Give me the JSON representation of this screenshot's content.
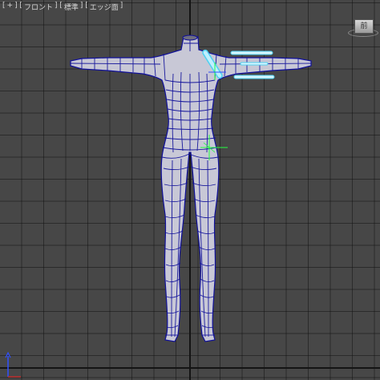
{
  "viewport": {
    "label_open": "[",
    "label_plus": "+",
    "label_mid1": "] [",
    "view_name": "フロント",
    "label_mid2": "] [",
    "shading_name": "標準",
    "label_mid3": "] [",
    "display_mode": "エッジ面",
    "label_close": "]"
  },
  "viewcube": {
    "face_label": "前"
  },
  "colors": {
    "background": "#474747",
    "grid_line": "#1e1e1e",
    "axis_line": "#141414",
    "mesh_fill": "#c8c8d6",
    "wire": "#10109a",
    "selection": "#4fd0f0",
    "gizmo_y": "#20ff40",
    "gizmo_x": "#3050ff"
  },
  "icons": {
    "viewcube": "viewcube-icon",
    "axis_gizmo": "axis-tripod-icon",
    "transform_gizmo": "move-gizmo-icon"
  }
}
